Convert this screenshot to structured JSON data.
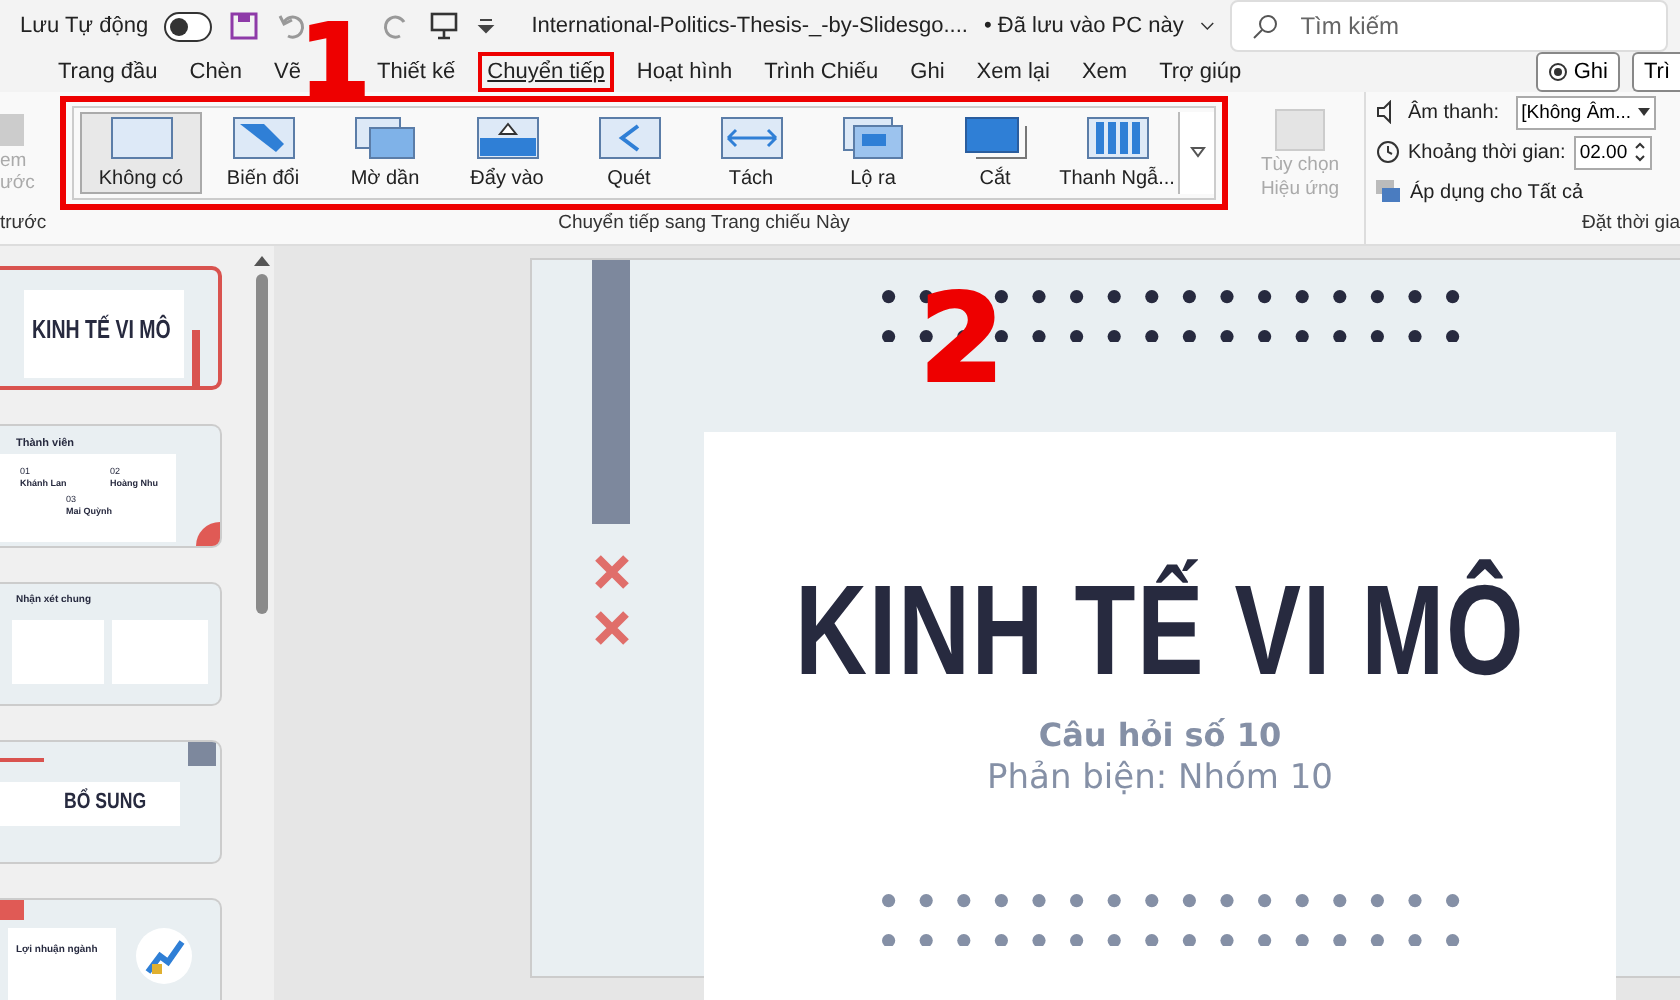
{
  "title_bar": {
    "autosave": {
      "label": "Lưu Tự động",
      "on": false
    },
    "quick_access": [
      {
        "kind": "save"
      },
      {
        "kind": "undo"
      },
      {
        "kind": "redo"
      },
      {
        "kind": "present"
      },
      {
        "kind": "more"
      }
    ],
    "document_title": "International-Politics-Thesis-_-by-Slidesgo....",
    "save_status": "• Đã lưu vào PC này",
    "search": {
      "placeholder": "Tìm kiếm"
    }
  },
  "menu_tabs": [
    {
      "label": "Trang đầu",
      "selected": false
    },
    {
      "label": "Chèn",
      "selected": false
    },
    {
      "label": "Vẽ",
      "selected": false
    },
    {
      "label": "Thiết kế",
      "selected": false
    },
    {
      "label": "Chuyển tiếp",
      "selected": true
    },
    {
      "label": "Hoạt hình",
      "selected": false
    },
    {
      "label": "Trình Chiếu",
      "selected": false
    },
    {
      "label": "Ghi",
      "selected": false
    },
    {
      "label": "Xem lại",
      "selected": false
    },
    {
      "label": "Xem",
      "selected": false
    },
    {
      "label": "Trợ giúp",
      "selected": false
    }
  ],
  "menu_right": {
    "record_button": "Ghi",
    "cut_button": "Trì"
  },
  "ribbon": {
    "preview_group": {
      "button_lines": [
        "em",
        "ước"
      ],
      "label": "trước",
      "disabled": true
    },
    "transition_group": {
      "label": "Chuyển tiếp sang Trang chiếu Này",
      "items": [
        {
          "label": "Không có",
          "kind": "none",
          "selected": true
        },
        {
          "label": "Biến đổi",
          "kind": "morph",
          "selected": false
        },
        {
          "label": "Mờ dần",
          "kind": "fade",
          "selected": false
        },
        {
          "label": "Đẩy vào",
          "kind": "push",
          "selected": false
        },
        {
          "label": "Quét",
          "kind": "wipe",
          "selected": false
        },
        {
          "label": "Tách",
          "kind": "split",
          "selected": false
        },
        {
          "label": "Lộ ra",
          "kind": "reveal",
          "selected": false
        },
        {
          "label": "Cắt",
          "kind": "cut",
          "selected": false
        },
        {
          "label": "Thanh Ngẫ...",
          "kind": "bars",
          "selected": false
        }
      ],
      "effect_options": {
        "lines": [
          "Tùy chọn",
          "Hiệu ứng"
        ],
        "disabled": true
      }
    },
    "timing_group": {
      "sound_label": "Âm thanh:",
      "sound_value": "[Không Âm...",
      "duration_label": "Khoảng thời gian:",
      "duration_value": "02.00",
      "apply_all": "Áp dụng cho Tất cả",
      "label": "Đặt thời gia"
    }
  },
  "slide_thumbnails": [
    {
      "kind": "title",
      "selected": true,
      "texts": [
        "KINH TẾ VI MÔ"
      ]
    },
    {
      "kind": "members",
      "selected": false,
      "texts": [
        "Thành viên",
        "01",
        "Khánh Lan",
        "02",
        "Hoàng Nhu",
        "03",
        "Mai Quỳnh"
      ]
    },
    {
      "kind": "review",
      "selected": false,
      "texts": [
        "Nhận xét chung"
      ]
    },
    {
      "kind": "section",
      "selected": false,
      "texts": [
        "BỔ SUNG"
      ]
    },
    {
      "kind": "chart",
      "selected": false,
      "texts": [
        "Lợi nhuận ngành"
      ]
    }
  ],
  "slide": {
    "title": "KINH TẾ VI MÔ",
    "subtitle": "Câu hỏi số 10",
    "caption": "Phản biện: Nhóm 10"
  },
  "annotations": [
    {
      "label": "1"
    },
    {
      "label": "2"
    }
  ]
}
